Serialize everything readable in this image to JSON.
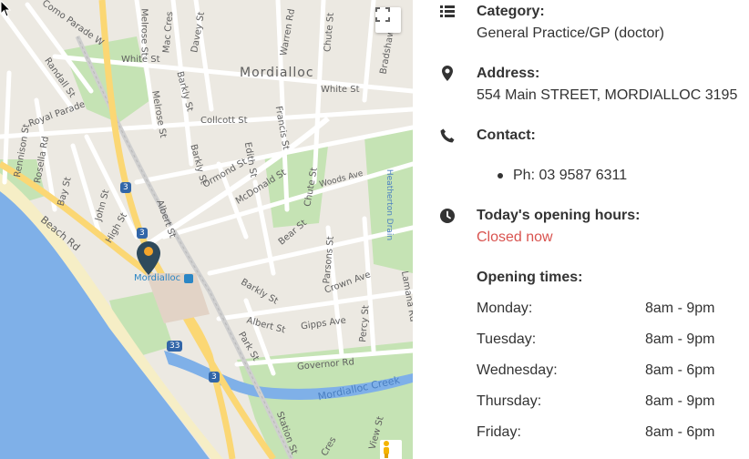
{
  "map": {
    "suburb_label": "Mordialloc",
    "station_label": "Mordialloc",
    "creek_label": "Mordialloc Creek",
    "drain_label": "Heatherton Drain",
    "route_badges": [
      "3",
      "3",
      "33",
      "3"
    ],
    "streets": {
      "como_parade_w": "Como Parade W",
      "randall_st": "Randall St",
      "royal_parade": "Royal Parade",
      "rennison_st": "Rennison St",
      "rosella_rd": "Rosella Rd",
      "bay_st": "Bay St",
      "john_st": "John St",
      "high_st": "High St",
      "beach_rd": "Beach Rd",
      "white_st_1": "White St",
      "white_st_2": "White St",
      "melrose_st_1": "Melrose St",
      "melrose_st_2": "Melrose St",
      "mac_cres": "Mac Cres",
      "davey_st": "Davey St",
      "warren_rd": "Warren Rd",
      "chute_st_1": "Chute St",
      "chute_st_2": "Chute St",
      "bradshaw_st": "Bradshaw St",
      "barkly_st_1": "Barkly St",
      "barkly_st_2": "Barkly St",
      "barkly_st_3": "Barkly St",
      "collcott_st": "Collcott St",
      "francis_st": "Francis St",
      "edith_st": "Edith St",
      "ormond_st": "Ormond St",
      "mcdonald_st": "McDonald St",
      "albert_st_1": "Albert St",
      "albert_st_2": "Albert St",
      "woods_ave": "Woods Ave",
      "bear_st": "Bear St",
      "parsons_st": "Parsons St",
      "crown_ave": "Crown Ave",
      "lamana_rd": "Lamana Rd",
      "gipps_ave": "Gipps Ave",
      "percy_st": "Percy St",
      "park_st": "Park St",
      "governor_rd": "Governor Rd",
      "station_st": "Station St",
      "cres": "Cres",
      "view_st": "View St"
    }
  },
  "info": {
    "category": {
      "label": "Category:",
      "value": "General Practice/GP (doctor)"
    },
    "address": {
      "label": "Address:",
      "value": "554 Main STREET, MORDIALLOC 3195"
    },
    "contact": {
      "label": "Contact:",
      "phone": "Ph: 03 9587 6311"
    },
    "today": {
      "label": "Today's opening hours:",
      "status": "Closed now"
    },
    "opening": {
      "label": "Opening times:",
      "days": [
        {
          "day": "Monday:",
          "hours": "8am - 9pm"
        },
        {
          "day": "Tuesday:",
          "hours": "8am - 9pm"
        },
        {
          "day": "Wednesday:",
          "hours": "8am - 6pm"
        },
        {
          "day": "Thursday:",
          "hours": "8am - 9pm"
        },
        {
          "day": "Friday:",
          "hours": "8am - 6pm"
        }
      ]
    }
  },
  "colors": {
    "closed": "#d9534f",
    "icon": "#333333",
    "water": "#7fb0e8",
    "park": "#c5e3b4",
    "major_road": "#fbd774"
  }
}
